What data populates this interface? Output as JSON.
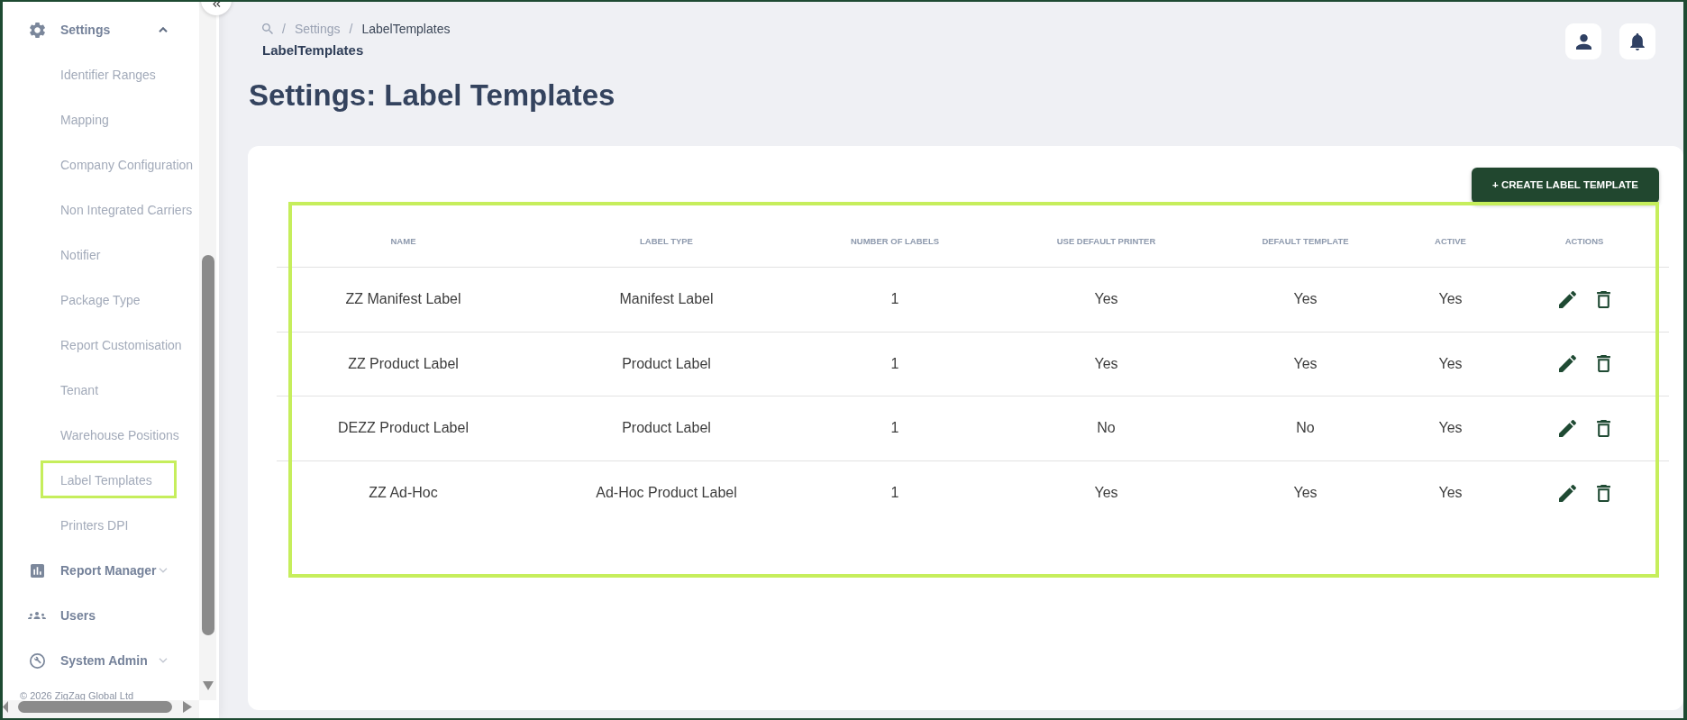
{
  "sidebar": {
    "sections": [
      {
        "kind": "group",
        "label": "Settings",
        "expanded": true,
        "items": [
          {
            "label": "Identifier Ranges",
            "highlighted": false
          },
          {
            "label": "Mapping",
            "highlighted": false
          },
          {
            "label": "Company Configuration",
            "highlighted": false
          },
          {
            "label": "Non Integrated Carriers",
            "highlighted": false
          },
          {
            "label": "Notifier",
            "highlighted": false
          },
          {
            "label": "Package Type",
            "highlighted": false
          },
          {
            "label": "Report Customisation",
            "highlighted": false
          },
          {
            "label": "Tenant",
            "highlighted": false
          },
          {
            "label": "Warehouse Positions",
            "highlighted": false
          },
          {
            "label": "Label Templates",
            "highlighted": true
          },
          {
            "label": "Printers DPI",
            "highlighted": false
          }
        ]
      },
      {
        "kind": "group",
        "label": "Report Manager",
        "expanded": false
      },
      {
        "kind": "link",
        "label": "Users"
      },
      {
        "kind": "group",
        "label": "System Admin",
        "expanded": false
      }
    ],
    "copyright": "© 2026 ZigZag Global Ltd"
  },
  "breadcrumb": {
    "items": [
      {
        "separator": "/",
        "label": "Settings",
        "current": false
      },
      {
        "separator": "/",
        "label": "LabelTemplates",
        "current": true
      }
    ],
    "page": "LabelTemplates"
  },
  "page_title": "Settings: Label Templates",
  "create_button": {
    "label": "+ CREATE LABEL TEMPLATE"
  },
  "table": {
    "highlighted": true,
    "columns": [
      "NAME",
      "LABEL TYPE",
      "NUMBER OF LABELS",
      "USE DEFAULT PRINTER",
      "DEFAULT TEMPLATE",
      "ACTIVE",
      "ACTIONS"
    ],
    "rows": [
      {
        "cells": [
          "ZZ Manifest Label",
          "Manifest Label",
          "1",
          "Yes",
          "Yes",
          "Yes"
        ]
      },
      {
        "cells": [
          "ZZ Product Label",
          "Product Label",
          "1",
          "Yes",
          "Yes",
          "Yes"
        ]
      },
      {
        "cells": [
          "DEZZ Product Label",
          "Product Label",
          "1",
          "No",
          "No",
          "Yes"
        ]
      },
      {
        "cells": [
          "ZZ Ad-Hoc",
          "Ad-Hoc Product Label",
          "1",
          "Yes",
          "Yes",
          "Yes"
        ]
      }
    ]
  }
}
